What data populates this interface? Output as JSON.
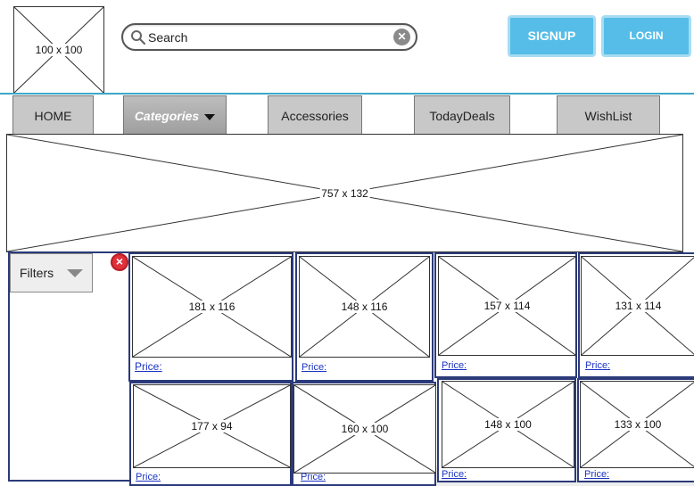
{
  "header": {
    "logo_label": "100 x 100",
    "search": {
      "value": "Search",
      "placeholder": "Search"
    },
    "signup_label": "SIGNUP",
    "login_label": "LOGIN"
  },
  "nav": {
    "tabs": [
      {
        "label": "HOME"
      },
      {
        "label": "Categories",
        "active": true
      },
      {
        "label": "Accessories"
      },
      {
        "label": "TodayDeals"
      },
      {
        "label": "WishList"
      }
    ]
  },
  "banner": {
    "label": "757 x 132"
  },
  "filters": {
    "label": "Filters"
  },
  "products": [
    {
      "image_label": "181 x 116",
      "price_label": "Price:"
    },
    {
      "image_label": "148 x 116",
      "price_label": "Price:"
    },
    {
      "image_label": "157 x 114",
      "price_label": "Price:"
    },
    {
      "image_label": "131 x 114",
      "price_label": "Price:"
    },
    {
      "image_label": "177 x 94",
      "price_label": "Price:"
    },
    {
      "image_label": "160 x 100",
      "price_label": "Price:"
    },
    {
      "image_label": "148 x 100",
      "price_label": "Price:"
    },
    {
      "image_label": "133 x 100",
      "price_label": "Price:"
    }
  ],
  "colors": {
    "accent": "#56bde8",
    "divider": "#3ba8c8",
    "card_border": "#2b3a7a",
    "link": "#1a33c4",
    "close": "#e0303a"
  }
}
